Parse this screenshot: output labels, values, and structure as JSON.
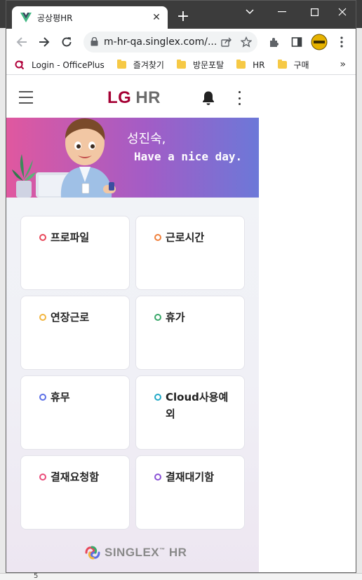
{
  "browser": {
    "tab_title": "공상평HR",
    "url": "m-hr-qa.singlex.com/...",
    "bookmarks": [
      {
        "label": "Login - OfficePlus",
        "type": "site"
      },
      {
        "label": "즐겨찾기",
        "type": "folder"
      },
      {
        "label": "방문포탈",
        "type": "folder"
      },
      {
        "label": "HR",
        "type": "folder"
      },
      {
        "label": "구매",
        "type": "folder"
      }
    ],
    "bookmarks_more": "»"
  },
  "app": {
    "logo_brand": "LG",
    "logo_product": "HR",
    "greeting_name": "성진숙,",
    "greeting_message": "Have a nice day.",
    "menu_cards": [
      {
        "label": "프로파일",
        "color": "#e8485a"
      },
      {
        "label": "근로시간",
        "color": "#f0803c"
      },
      {
        "label": "연장근로",
        "color": "#f2b540"
      },
      {
        "label": "휴가",
        "color": "#3aa86a"
      },
      {
        "label": "휴무",
        "color": "#5b6fe6"
      },
      {
        "label": "Cloud사용예외",
        "color": "#21a9c7"
      },
      {
        "label": "결재요청함",
        "color": "#ea4b79"
      },
      {
        "label": "결재대기함",
        "color": "#8a52d6"
      }
    ],
    "footer_brand": "SINGLEX",
    "footer_tm": "™",
    "footer_product": "HR"
  },
  "backdrop": {
    "bottom_text": "5"
  }
}
